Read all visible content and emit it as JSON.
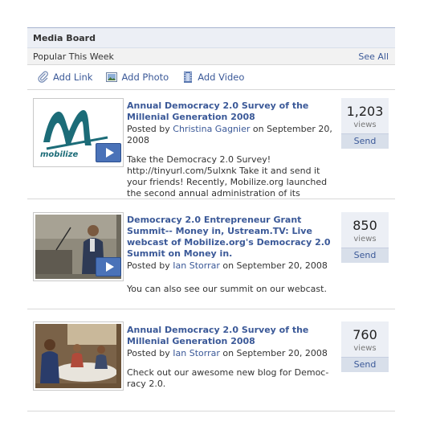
{
  "board": {
    "title": "Media Board",
    "subtitle": "Popular This Week",
    "see_all": "See All"
  },
  "actions": [
    {
      "label": "Add Link",
      "icon": "paperclip-icon"
    },
    {
      "label": "Add Photo",
      "icon": "photo-icon"
    },
    {
      "label": "Add Video",
      "icon": "film-icon"
    }
  ],
  "items": [
    {
      "title": "Annual Democracy 2.0 Survey of the Millenial Generation 2008",
      "posted_prefix": "Posted by ",
      "author": "Christina Gagnier",
      "date": " on September 20, 2008",
      "description": "Take the Democracy 2.0 Survey! http://tinyurl.com/5ulxnk Take it and send it your friends! Recently, Mobilize.org launched the second annual administration of its",
      "views": "1,203",
      "views_label": "views",
      "send_label": "Send",
      "thumb_logo_text": "mobilize"
    },
    {
      "title": "Democracy 2.0 Entrepreneur Grant Summit-- Money in, Ustream.TV: Live webcast of Mobilize.org's Democracy 2.0 Summit on Money in.",
      "posted_prefix": "Posted by ",
      "author": "Ian Storrar",
      "date": " on September 20, 2008",
      "description": "You can also see our summit on our webcast.",
      "views": "850",
      "views_label": "views",
      "send_label": "Send"
    },
    {
      "title": "Annual Democracy 2.0 Survey of the Millenial Generation 2008",
      "posted_prefix": "Posted by ",
      "author": "Ian Storrar",
      "date": " on September 20, 2008",
      "description": "Check out our awesome new blog for Democ- racy 2.0.",
      "views": "760",
      "views_label": "views",
      "send_label": "Send"
    }
  ]
}
